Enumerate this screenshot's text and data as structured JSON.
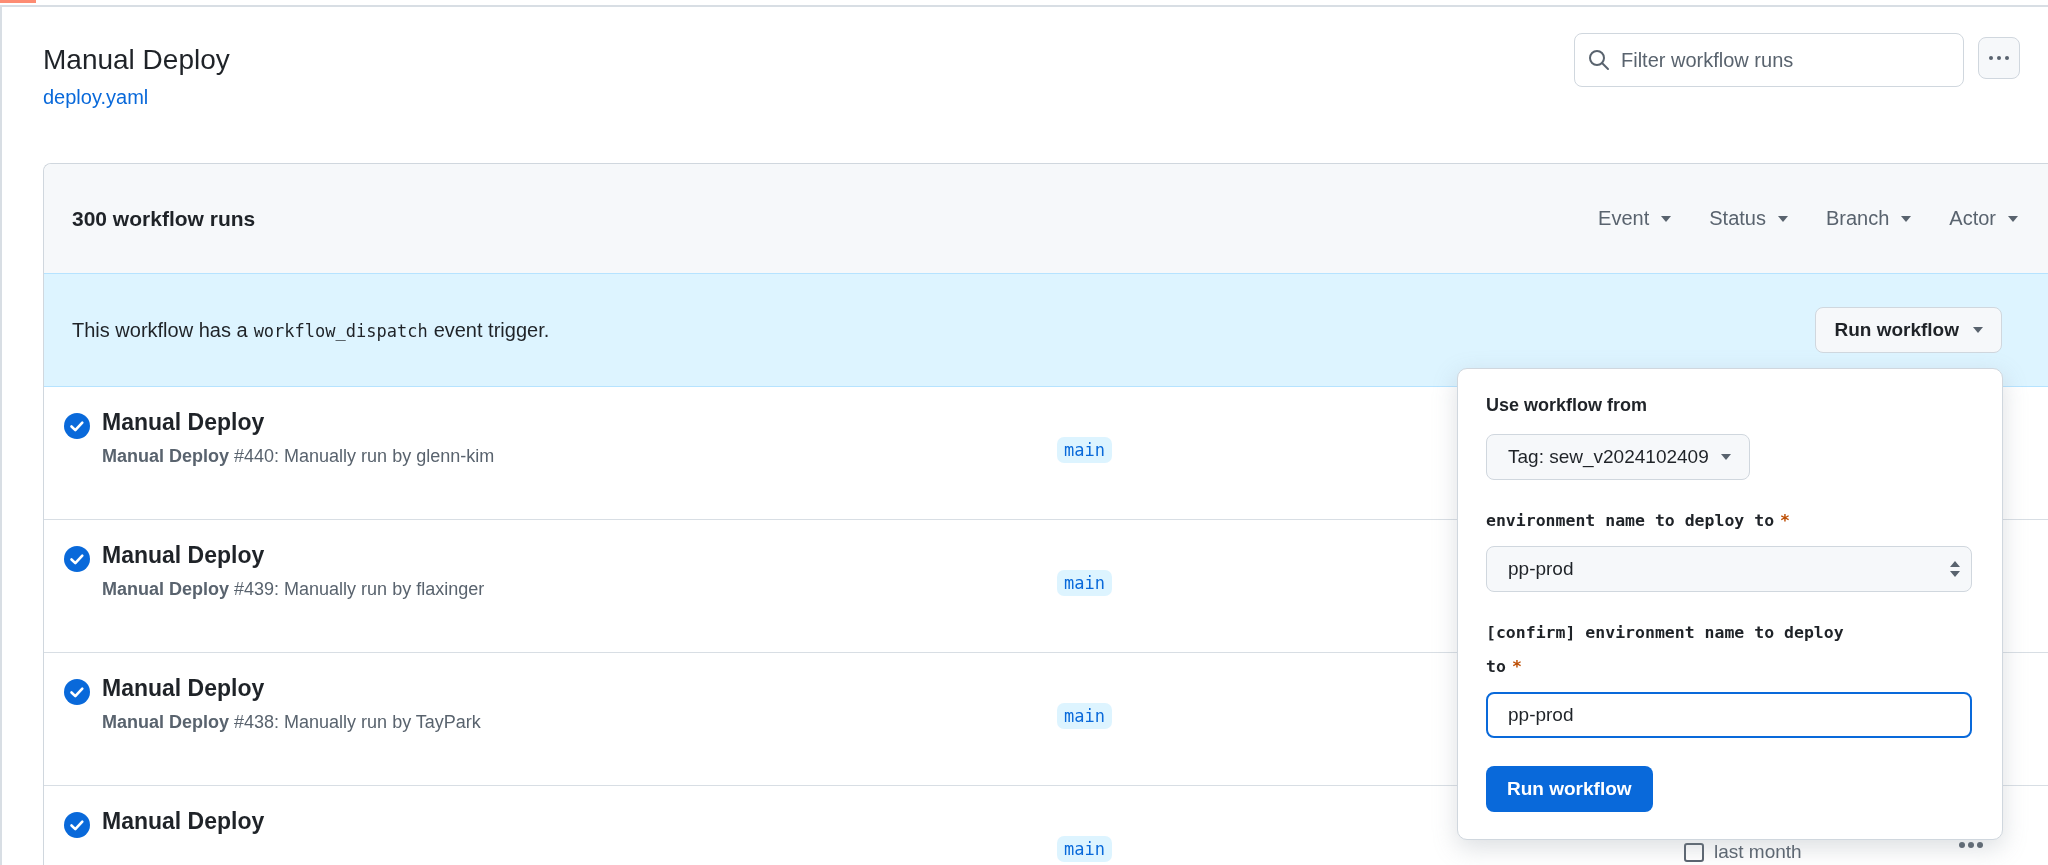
{
  "page": {
    "title": "Manual Deploy",
    "file_link": "deploy.yaml",
    "filter": {
      "placeholder": "Filter workflow runs"
    }
  },
  "runs_list": {
    "count": "300 workflow runs",
    "filters": [
      "Event",
      "Status",
      "Branch",
      "Actor"
    ]
  },
  "banner": {
    "text_before": "This workflow has a",
    "code": "workflow_dispatch",
    "text_after": "event trigger.",
    "button": "Run workflow"
  },
  "runs": [
    {
      "title": "Manual Deploy",
      "detail": "**Manual Deploy** #440: Manually run by glenn-kim",
      "branch": "main",
      "kind": "success"
    },
    {
      "title": "Manual Deploy",
      "detail": "**Manual Deploy** #439: Manually run by flaxinger",
      "branch": "main",
      "kind": "success"
    },
    {
      "title": "Manual Deploy",
      "detail": "**Manual Deploy** #438: Manually run by TayPark",
      "branch": "main",
      "kind": "success"
    },
    {
      "title": "Manual Deploy",
      "branch": "main",
      "kind": "success",
      "when": "last month"
    }
  ],
  "panel": {
    "heading": "Use workflow from",
    "ref_button": "Tag: sew_v2024102409",
    "fields": [
      {
        "kind": "select",
        "label": "environment name to deploy to",
        "required_mark": "*",
        "value": "pp-prod",
        "focused": false
      },
      {
        "kind": "text",
        "label": "[confirm] environment name to deploy to",
        "required_mark": "*",
        "value": "pp-prod",
        "focused": true
      }
    ],
    "submit": "Run workflow"
  }
}
